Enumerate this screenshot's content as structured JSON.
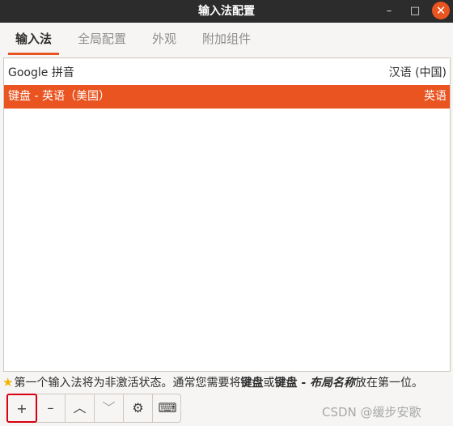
{
  "window": {
    "title": "输入法配置",
    "controls": {
      "minimize": "–",
      "maximize": "□",
      "close": "✕"
    }
  },
  "tabs": [
    {
      "label": "输入法",
      "active": true
    },
    {
      "label": "全局配置",
      "active": false
    },
    {
      "label": "外观",
      "active": false
    },
    {
      "label": "附加组件",
      "active": false
    }
  ],
  "input_methods": [
    {
      "name": "Google 拼音",
      "language": "汉语 (中国)",
      "selected": false
    },
    {
      "name": "键盘 - 英语（美国）",
      "language": "英语",
      "selected": true
    }
  ],
  "hint": {
    "icon": "star-icon",
    "part1": "第一个输入法将为非激活状态。通常您需要将",
    "bold1": "键盘",
    "part2": "或",
    "bold2": "键盘 - ",
    "italic_bold": "布局名称",
    "part3": "放在第一位。"
  },
  "toolbar": {
    "add": "+",
    "remove": "–",
    "up": "︿",
    "down": "﹀",
    "configure": "⚙",
    "keyboard": "⌨"
  },
  "watermark": "CSDN @缓步安歌",
  "colors": {
    "accent": "#e95420",
    "titlebar": "#2c2c2c",
    "highlight_border": "#d7000f"
  }
}
